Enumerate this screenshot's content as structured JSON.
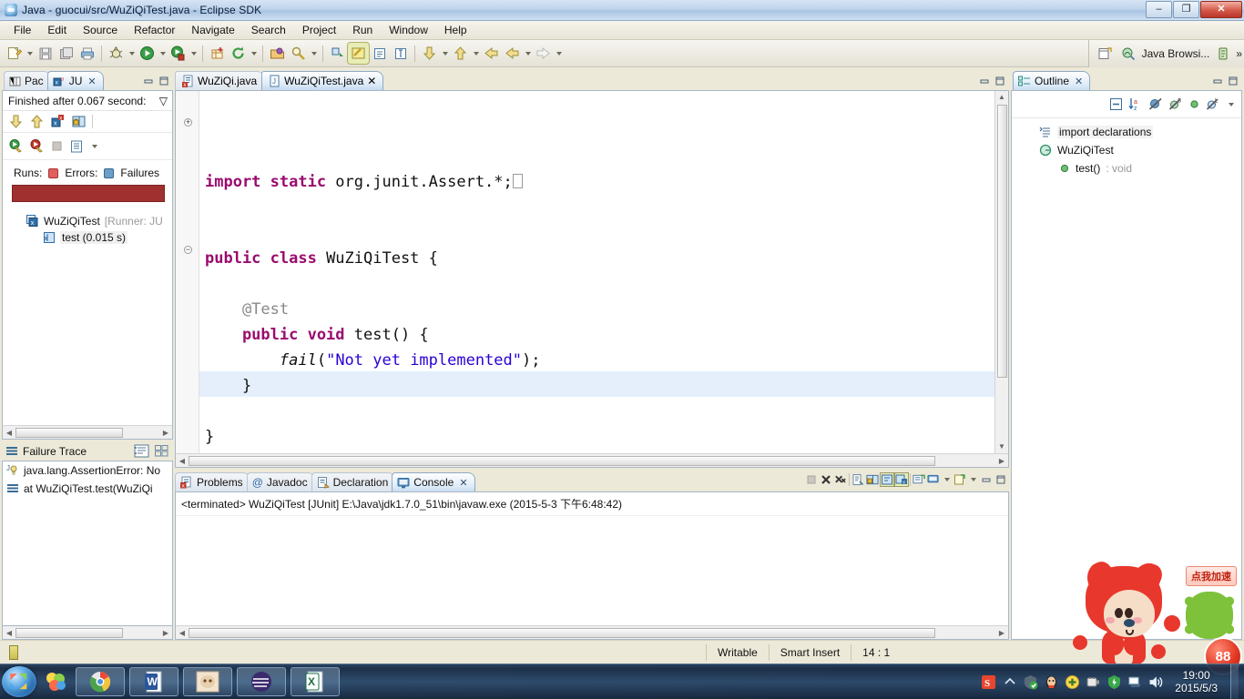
{
  "window": {
    "title": "Java - guocui/src/WuZiQiTest.java - Eclipse SDK",
    "minimize_label": "–",
    "restore_label": "❐",
    "close_label": "✕"
  },
  "menubar": {
    "items": [
      "File",
      "Edit",
      "Source",
      "Refactor",
      "Navigate",
      "Search",
      "Project",
      "Run",
      "Window",
      "Help"
    ]
  },
  "toolbar": {
    "perspective_label": "Java Browsi...",
    "overflow_label": "»",
    "icons": [
      "new-wizard-icon",
      "new-dropdown-arrow",
      "save-icon",
      "save-all-icon",
      "print-icon",
      "debug-icon",
      "debug-dropdown-arrow",
      "run-icon",
      "run-dropdown-arrow",
      "run-coverage-icon",
      "coverage-dropdown-arrow",
      "new-java-package-icon",
      "external-tools-icon",
      "external-tools-dropdown-arrow",
      "open-type-icon",
      "search-icon",
      "search-dropdown-arrow",
      "next-annotation-icon",
      "toggle-mark-occurrences-icon",
      "show-whitespace-icon",
      "show-print-margin-icon",
      "next-edit-icon",
      "next-dropdown-arrow",
      "previous-edit-icon",
      "previous-dropdown-arrow",
      "back-icon",
      "forward-icon",
      "forward-dropdown-arrow",
      "forward-disabled-icon",
      "forward-disabled-arrow"
    ]
  },
  "junit_view": {
    "tabs": [
      {
        "label": "Pac",
        "icon": "package-explorer-icon",
        "active": false
      },
      {
        "label": "JU",
        "icon": "junit-icon",
        "active": true,
        "close": "✕"
      }
    ],
    "status": "Finished after 0.067 second:",
    "status_menu": "▽",
    "toolbar_row1": [
      "next-failure-icon",
      "previous-failure-icon",
      "show-failures-only-icon",
      "lock-scroll-icon"
    ],
    "toolbar_row2": [
      "rerun-test-icon",
      "rerun-failed-icon",
      "stop-icon",
      "test-history-icon",
      "view-menu-arrow"
    ],
    "counters": {
      "runs_label": "Runs:",
      "errors_label": "Errors:",
      "failures_label": "Failures"
    },
    "progress_color": "#a03030",
    "tree": [
      {
        "label": "WuZiQiTest",
        "suffix": "[Runner: JU",
        "icon": "test-class-icon",
        "indent": 1
      },
      {
        "label": "test (0.015 s)",
        "icon": "test-method-icon",
        "indent": 2
      }
    ]
  },
  "failure_trace": {
    "title": "Failure Trace",
    "header_icon": "failure-trace-icon",
    "buttons": [
      "filter-stacktrace-icon",
      "compare-result-icon"
    ],
    "rows": [
      {
        "icon": "exception-icon",
        "label": "java.lang.AssertionError: No"
      },
      {
        "icon": "stack-frame-icon",
        "label": "at WuZiQiTest.test(WuZiQi"
      }
    ]
  },
  "editor": {
    "tabs": [
      {
        "label": "WuZiQi.java",
        "icon": "java-error-file-icon",
        "active": false
      },
      {
        "label": "WuZiQiTest.java",
        "icon": "java-file-icon",
        "active": true,
        "close": "✕"
      }
    ],
    "minimize_label": "–",
    "maximize_label": "❐",
    "code_lines": [
      {
        "tokens": [
          {
            "t": "import static ",
            "c": "kw"
          },
          {
            "t": "org.junit.Assert.*;",
            "c": "pln"
          }
        ],
        "caret": true
      },
      {
        "tokens": []
      },
      {
        "tokens": []
      },
      {
        "tokens": [
          {
            "t": "public class ",
            "c": "kw"
          },
          {
            "t": "WuZiQiTest {",
            "c": "pln"
          }
        ]
      },
      {
        "tokens": []
      },
      {
        "tokens": [
          {
            "t": "    @Test",
            "c": "ann"
          }
        ]
      },
      {
        "tokens": [
          {
            "t": "    public void ",
            "c": "kw"
          },
          {
            "t": "test() {",
            "c": "pln"
          }
        ]
      },
      {
        "tokens": [
          {
            "t": "        fail",
            "c": "mth"
          },
          {
            "t": "(",
            "c": "pln"
          },
          {
            "t": "\"Not yet implemented\"",
            "c": "str"
          },
          {
            "t": ");",
            "c": "pln"
          }
        ]
      },
      {
        "tokens": [
          {
            "t": "    }",
            "c": "pln"
          }
        ]
      },
      {
        "tokens": []
      },
      {
        "tokens": [
          {
            "t": "}",
            "c": "pln"
          }
        ]
      }
    ],
    "fold_markers": [
      "expand-fold-icon",
      "collapse-fold-icon"
    ]
  },
  "console_view": {
    "tabs": [
      {
        "label": "Problems",
        "icon": "problems-icon",
        "active": false
      },
      {
        "label": "Javadoc",
        "icon": "javadoc-icon",
        "active": false
      },
      {
        "label": "Declaration",
        "icon": "declaration-icon",
        "active": false
      },
      {
        "label": "Console",
        "icon": "console-icon",
        "active": true,
        "close": "✕"
      }
    ],
    "output": "<terminated> WuZiQiTest [JUnit] E:\\Java\\jdk1.7.0_51\\bin\\javaw.exe (2015-5-3 下午6:48:42)",
    "toolbar": [
      "terminate-icon",
      "remove-launch-icon",
      "remove-all-launches-icon",
      "clear-console-icon",
      "scroll-lock-icon",
      "word-wrap-icon",
      "show-console-on-output-icon",
      "pin-console-icon",
      "display-selected-console-icon",
      "display-dropdown-arrow",
      "open-console-icon",
      "open-console-dropdown-arrow",
      "minimize-icon",
      "maximize-icon"
    ]
  },
  "outline_view": {
    "tab": {
      "label": "Outline",
      "icon": "outline-icon",
      "close": "✕"
    },
    "minimize_label": "–",
    "maximize_label": "❐",
    "toolbar": [
      "collapse-all-icon",
      "sort-icon",
      "hide-fields-icon",
      "hide-static-icon",
      "hide-non-public-icon",
      "hide-local-types-icon",
      "view-menu-arrow"
    ],
    "items": [
      {
        "label": "import declarations",
        "icon": "import-declarations-icon",
        "indent": 1,
        "selected": true
      },
      {
        "label": "WuZiQiTest",
        "icon": "class-icon",
        "indent": 1
      },
      {
        "label": "test()",
        "suffix": " : void",
        "icon": "method-public-icon",
        "indent": 2
      }
    ]
  },
  "statusbar": {
    "indicator_icon": "writable-indicator-icon",
    "writable": "Writable",
    "insert_mode": "Smart Insert",
    "position": "14 : 1"
  },
  "taskbar": {
    "start_label": "start-orb-icon",
    "pinned": [
      "media-player-icon",
      "browser-icon"
    ],
    "tasks": [
      {
        "icon": "chrome-icon",
        "name": "chrome-task"
      },
      {
        "icon": "word-icon",
        "name": "word-task"
      },
      {
        "icon": "photo-icon",
        "name": "photo-task"
      },
      {
        "icon": "eclipse-icon",
        "name": "eclipse-task"
      },
      {
        "icon": "excel-icon",
        "name": "excel-task"
      }
    ],
    "tray": [
      "sogou-input-icon",
      "show-hidden-icons-arrow",
      "antivirus-icon",
      "qq-icon",
      "update-icon",
      "power-icon",
      "security-shield-icon",
      "network-icon",
      "volume-icon"
    ],
    "clock_time": "19:00",
    "clock_date": "2015/5/3"
  },
  "mascot": {
    "badge_text": "点我加速",
    "counter": "88",
    "name": "sogou-fox-mascot"
  }
}
